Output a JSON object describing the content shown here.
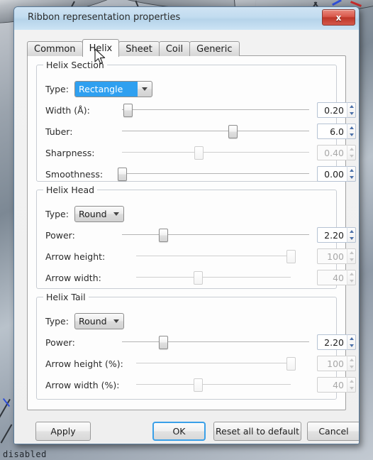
{
  "desktop": {
    "bottom_text": "disabled"
  },
  "window": {
    "title": "Ribbon representation properties",
    "close_label": "x"
  },
  "tabs": [
    {
      "label": "Common",
      "selected": false
    },
    {
      "label": "Helix",
      "selected": true
    },
    {
      "label": "Sheet",
      "selected": false
    },
    {
      "label": "Coil",
      "selected": false
    },
    {
      "label": "Generic",
      "selected": false
    }
  ],
  "groups": [
    {
      "title": "Helix Section",
      "rows": [
        {
          "kind": "combo",
          "label": "Type:",
          "value": "Rectangle",
          "highlighted": true
        },
        {
          "kind": "slider",
          "label": "Width (Å):",
          "value": "0.20",
          "fraction": 0.03,
          "disabled": false,
          "suffix": ""
        },
        {
          "kind": "slider",
          "label": "Tuber:",
          "value": "6.0",
          "fraction": 0.59,
          "disabled": false,
          "suffix": ""
        },
        {
          "kind": "slider",
          "label": "Sharpness:",
          "value": "0.40",
          "fraction": 0.41,
          "disabled": true,
          "suffix": ""
        },
        {
          "kind": "slider",
          "label": "Smoothness:",
          "value": "0.00",
          "fraction": 0.0,
          "disabled": false,
          "suffix": ""
        }
      ]
    },
    {
      "title": "Helix Head",
      "rows": [
        {
          "kind": "combo",
          "label": "Type:",
          "value": "Round",
          "highlighted": false
        },
        {
          "kind": "slider",
          "label": "Power:",
          "value": "2.20",
          "fraction": 0.22,
          "disabled": false,
          "suffix": ""
        },
        {
          "kind": "slider",
          "label": "Arrow height:",
          "value": "100",
          "fraction": 1.0,
          "disabled": true,
          "suffix": "%"
        },
        {
          "kind": "slider",
          "label": "Arrow width:",
          "value": "40",
          "fraction": 0.4,
          "disabled": true,
          "suffix": "%"
        }
      ]
    },
    {
      "title": "Helix Tail",
      "rows": [
        {
          "kind": "combo",
          "label": "Type:",
          "value": "Round",
          "highlighted": false
        },
        {
          "kind": "slider",
          "label": "Power:",
          "value": "2.20",
          "fraction": 0.22,
          "disabled": false,
          "suffix": ""
        },
        {
          "kind": "slider",
          "label": "Arrow height (%):",
          "value": "100",
          "fraction": 1.0,
          "disabled": true,
          "suffix": ""
        },
        {
          "kind": "slider",
          "label": "Arrow width (%):",
          "value": "40",
          "fraction": 0.4,
          "disabled": true,
          "suffix": ""
        }
      ]
    }
  ],
  "buttons": [
    {
      "label": "Apply",
      "default": false
    },
    {
      "label": "OK",
      "default": true
    },
    {
      "label": "Reset all to default",
      "default": false
    },
    {
      "label": "Cancel",
      "default": false
    }
  ]
}
